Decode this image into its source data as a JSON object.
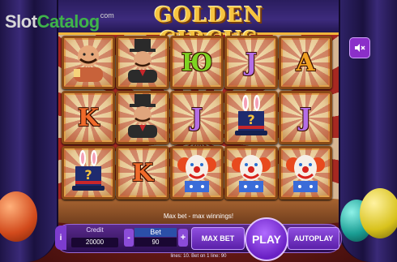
{
  "logo": {
    "part1": "Slot",
    "part2": "Catalog",
    "suffix": "com"
  },
  "title": "GOLDEN CIRCUS",
  "colors": {
    "accent_purple": "#8b2fc9",
    "gold": "#f6c440",
    "red_stripe": "#b02a23"
  },
  "mute_icon": "speaker-mute-icon",
  "reels": [
    [
      "strongman",
      "ringmaster",
      "Ю",
      "J",
      "A"
    ],
    [
      "K",
      "ringmaster",
      "J",
      "magic-hat",
      "J"
    ],
    [
      "magic-hat",
      "K",
      "clown",
      "clown",
      "clown"
    ]
  ],
  "message": "Max bet - max winnings!",
  "controls": {
    "info": "i",
    "credit_label": "Credit",
    "credit_value": "20000",
    "bet_minus": "-",
    "bet_label": "Bet",
    "bet_value": "90",
    "bet_plus": "+",
    "max_bet": "MAX BET",
    "play": "PLAY",
    "autoplay": "AUTOPLAY"
  },
  "footer": "lines: 10.   Bet on 1 line: 90"
}
